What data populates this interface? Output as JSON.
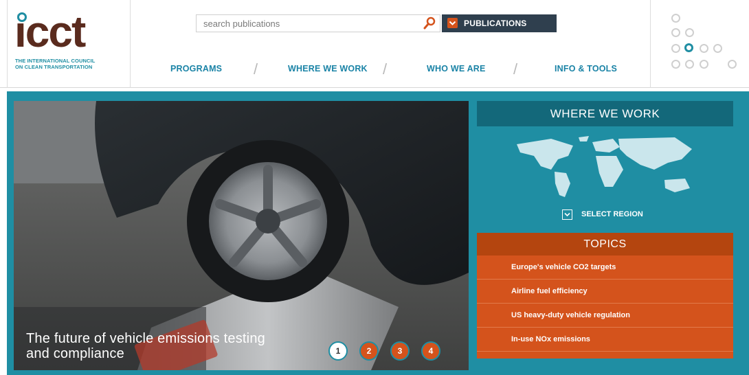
{
  "logo": {
    "mark": "icct",
    "subtitle_line1": "THE INTERNATIONAL COUNCIL",
    "subtitle_line2": "ON CLEAN TRANSPORTATION"
  },
  "search": {
    "placeholder": "search publications",
    "icon": "search-icon"
  },
  "publications_button": {
    "label": "PUBLICATIONS",
    "icon": "chevron-down-icon"
  },
  "nav": {
    "items": [
      {
        "label": "PROGRAMS"
      },
      {
        "label": "WHERE WE WORK"
      },
      {
        "label": "WHO WE ARE"
      },
      {
        "label": "INFO & TOOLS"
      }
    ],
    "separator": "/"
  },
  "hero": {
    "caption_line1": "The future of vehicle emissions testing",
    "caption_line2": "and compliance",
    "slides": [
      "1",
      "2",
      "3",
      "4"
    ],
    "active_slide": 1
  },
  "where_we_work": {
    "title": "WHERE WE WORK",
    "select_label": "SELECT REGION"
  },
  "topics": {
    "title": "TOPICS",
    "items": [
      {
        "label": "Europe's vehicle CO2 targets"
      },
      {
        "label": "Airline fuel efficiency"
      },
      {
        "label": "US heavy-duty vehicle regulation"
      },
      {
        "label": "In-use NOx emissions"
      }
    ]
  },
  "colors": {
    "teal": "#1f8ea3",
    "dark_teal": "#13687a",
    "orange": "#d4531c",
    "dark_orange": "#b4450f",
    "navy": "#2f3f4e",
    "brown": "#5a2b1e"
  }
}
